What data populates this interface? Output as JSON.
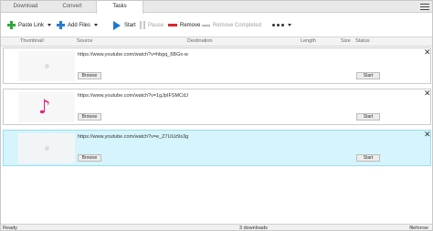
{
  "tabs": [
    {
      "label": "Download",
      "active": false
    },
    {
      "label": "Convert",
      "active": false
    },
    {
      "label": "Tasks",
      "active": true
    }
  ],
  "toolbar": {
    "paste_link": "Paste Link",
    "add_files": "Add Files",
    "start": "Start",
    "pause": "Pause",
    "remove": "Remove",
    "remove_completed": "Remove Completed"
  },
  "columns": {
    "thumbnail": "Thumbnail",
    "source": "Source",
    "destination": "Destination",
    "length": "Length",
    "size": "Size",
    "status": "Status"
  },
  "tasks": [
    {
      "source": "https://www.youtube.com/watch?v=hbgq_6BGx-w",
      "browse": "Browse",
      "start": "Start",
      "thumbnail": "placeholder",
      "selected": false
    },
    {
      "source": "https://www.youtube.com/watch?v=1gJpIFSMCdJ",
      "browse": "Browse",
      "start": "Start",
      "thumbnail": "music-note-icon",
      "selected": false
    },
    {
      "source": "https://www.youtube.com/watch?v=e_Z7UUz9s3g",
      "browse": "Browse",
      "start": "Start",
      "thumbnail": "placeholder",
      "selected": true
    }
  ],
  "status": {
    "state": "Ready",
    "downloads": "3 downloads",
    "watermark": "filehorse"
  },
  "colors": {
    "accent_blue": "#1a78d6",
    "add_green": "#2fa93e",
    "remove_red": "#d9252a",
    "selected_row": "#d6f4fc",
    "music_pink": "#e0237b"
  }
}
